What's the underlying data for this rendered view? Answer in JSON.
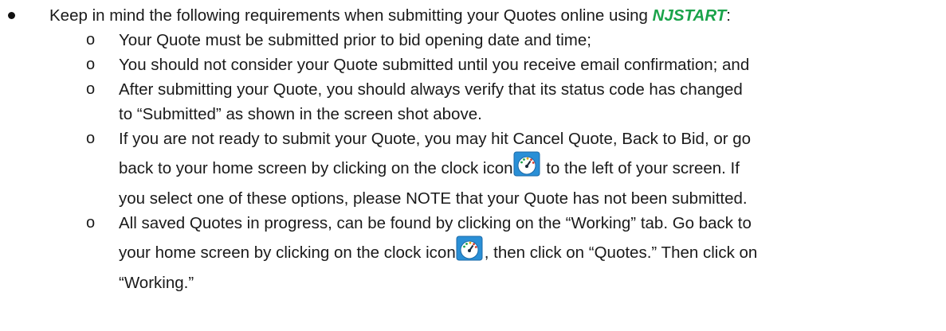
{
  "bullet": {
    "intro": "Keep in mind the following requirements when submitting your Quotes online using ",
    "brand": "NJSTART",
    "colon": ":"
  },
  "sub_marker": "o",
  "items": [
    {
      "text": "Your Quote must be submitted prior to bid opening date and time;"
    },
    {
      "text": "You should not consider your Quote submitted until you receive email confirmation; and"
    },
    {
      "line1": "After submitting your Quote, you should always verify that its status code has changed",
      "line2": "to “Submitted” as shown in the screen shot above."
    },
    {
      "line1": "If you are not ready to submit your Quote, you may hit Cancel Quote, Back to Bid, or go",
      "line2_before": "back to your home screen by clicking on the clock icon",
      "line2_after": " to the left of your screen. If",
      "line3": "you select one of these options, please NOTE that your Quote has not been submitted."
    },
    {
      "line1": "All saved Quotes in progress, can be found by clicking on the “Working” tab. Go back to",
      "line2_before": "your home screen by clicking on the clock icon",
      "line2_after": ", then click on “Quotes.” Then click on",
      "line3": "“Working.”"
    }
  ],
  "colors": {
    "brand": "#1aa34a",
    "icon_bg": "#2a8fd6",
    "icon_dial": "#ffffff"
  },
  "icon": "dashboard-clock-icon"
}
